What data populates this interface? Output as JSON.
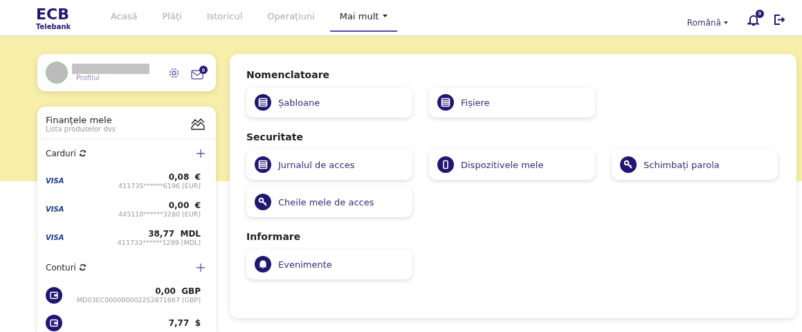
{
  "logo": {
    "mark": "ECB",
    "sub": "Telebank"
  },
  "nav": [
    {
      "label": "Acasă",
      "selected": false
    },
    {
      "label": "Plăți",
      "selected": false
    },
    {
      "label": "Istoricul",
      "selected": false
    },
    {
      "label": "Operațiuni",
      "selected": false
    },
    {
      "label": "Mai mult",
      "selected": true,
      "dropdown": true
    }
  ],
  "language": "Română",
  "notifications": "0",
  "profile": {
    "link": "Profilul",
    "messages": "0"
  },
  "finances": {
    "title": "Finanțele mele",
    "subtitle": "Lista produselor dvs",
    "groups": [
      {
        "title": "Carduri",
        "items": [
          {
            "kind": "card",
            "brand": "VISA",
            "amount": "0,08  €",
            "number": "411735******6196 [EUR]"
          },
          {
            "kind": "card",
            "brand": "VISA",
            "amount": "0,00  €",
            "number": "445110******3280 [EUR]"
          },
          {
            "kind": "card",
            "brand": "VISA",
            "amount": "38,77  MDL",
            "number": "411733******1289 [MDL]"
          }
        ]
      },
      {
        "title": "Conturi",
        "items": [
          {
            "kind": "account",
            "amount": "0,00  GBP",
            "number": "MD03EC000000002252871667 [GBP]"
          },
          {
            "kind": "account",
            "amount": "7,77  $"
          }
        ]
      }
    ]
  },
  "sections": [
    {
      "title": "Nomenclatoare",
      "items": [
        {
          "kind": "list",
          "label": "Șabloane"
        },
        {
          "kind": "list",
          "label": "Fișiere"
        }
      ]
    },
    {
      "title": "Securitate",
      "items": [
        {
          "kind": "list",
          "label": "Jurnalul de acces"
        },
        {
          "kind": "phone",
          "label": "Dispozitivele mele"
        },
        {
          "kind": "key",
          "label": "Schimbați parola"
        },
        {
          "kind": "key",
          "label": "Cheile mele de acces"
        }
      ]
    },
    {
      "title": "Informare",
      "items": [
        {
          "kind": "bell",
          "label": "Evenimente"
        }
      ]
    }
  ]
}
